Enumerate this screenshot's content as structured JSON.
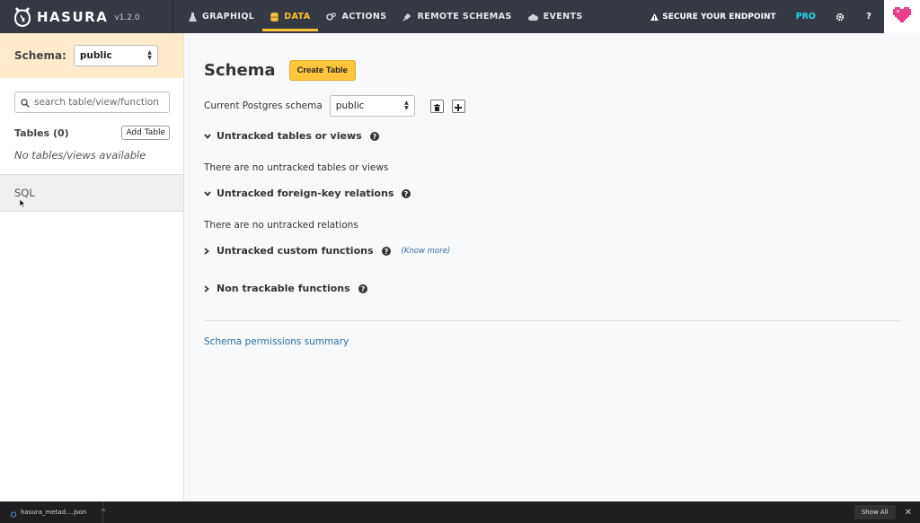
{
  "navbar": {
    "brand": "HASURA",
    "version": "v1.2.0",
    "tabs": [
      {
        "label": "GRAPHIQL",
        "icon": "flask-icon",
        "active": false
      },
      {
        "label": "DATA",
        "icon": "database-icon",
        "active": true
      },
      {
        "label": "ACTIONS",
        "icon": "cogs-icon",
        "active": false
      },
      {
        "label": "REMOTE SCHEMAS",
        "icon": "plug-icon",
        "active": false
      },
      {
        "label": "EVENTS",
        "icon": "cloud-icon",
        "active": false
      }
    ],
    "secure_label": "SECURE YOUR ENDPOINT",
    "pro_label": "PRO",
    "help_label": "?",
    "colors": {
      "bg": "#343944",
      "active": "#f8c233",
      "pro": "#1fd6e5"
    }
  },
  "sidebar": {
    "schema_label": "Schema:",
    "schema_value": "public",
    "search_placeholder": "search table/view/function",
    "tables_label": "Tables (0)",
    "add_table_label": "Add Table",
    "empty_text": "No tables/views available",
    "sql_label": "SQL"
  },
  "main": {
    "title": "Schema",
    "create_table_label": "Create Table",
    "pg_schema_label": "Current Postgres schema",
    "pg_schema_value": "public",
    "sections": [
      {
        "title": "Untracked tables or views",
        "expanded": true,
        "message": "There are no untracked tables or views"
      },
      {
        "title": "Untracked foreign-key relations",
        "expanded": true,
        "message": "There are no untracked relations"
      },
      {
        "title": "Untracked custom functions",
        "expanded": false,
        "extra": "(Know more)"
      },
      {
        "title": "Non trackable functions",
        "expanded": false
      }
    ],
    "permissions_link": "Schema permissions summary"
  },
  "downloads": {
    "file": "hasura_metad....json",
    "show_all": "Show All",
    "close": "✕"
  }
}
